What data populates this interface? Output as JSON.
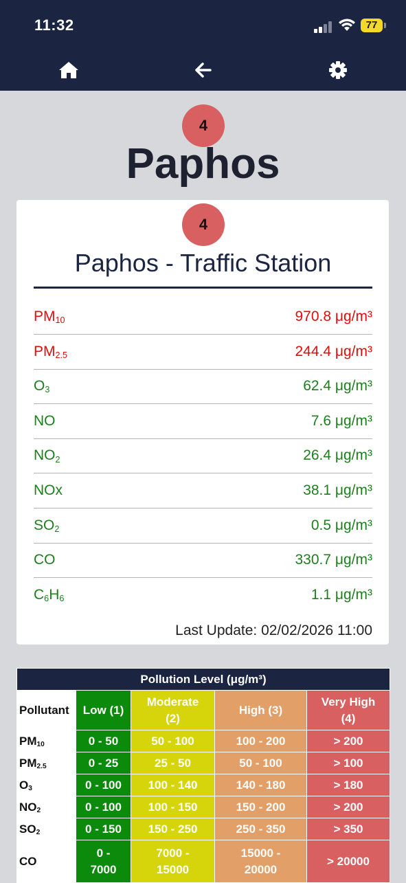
{
  "status_bar": {
    "time": "11:32",
    "battery": "77"
  },
  "nav": {
    "home_icon": "home-icon",
    "back_icon": "arrow-left-icon",
    "settings_icon": "gear-icon"
  },
  "city": {
    "name": "Paphos",
    "level": "4"
  },
  "station": {
    "name": "Paphos - Traffic Station",
    "level": "4",
    "pollutants": [
      {
        "base": "PM",
        "sub": "10",
        "tail": "",
        "value": "970.8 μg/m³",
        "status": "red"
      },
      {
        "base": "PM",
        "sub": "2.5",
        "tail": "",
        "value": "244.4 μg/m³",
        "status": "red"
      },
      {
        "base": "O",
        "sub": "3",
        "tail": "",
        "value": "62.4 μg/m³",
        "status": "green"
      },
      {
        "base": "NO",
        "sub": "",
        "tail": "",
        "value": "7.6 μg/m³",
        "status": "green"
      },
      {
        "base": "NO",
        "sub": "2",
        "tail": "",
        "value": "26.4 μg/m³",
        "status": "green"
      },
      {
        "base": "NOx",
        "sub": "",
        "tail": "",
        "value": "38.1 μg/m³",
        "status": "green"
      },
      {
        "base": "SO",
        "sub": "2",
        "tail": "",
        "value": "0.5 μg/m³",
        "status": "green"
      },
      {
        "base": "CO",
        "sub": "",
        "tail": "",
        "value": "330.7 μg/m³",
        "status": "green"
      },
      {
        "base": "C",
        "sub": "6",
        "tail": "H",
        "sub2": "6",
        "value": "1.1 μg/m³",
        "status": "green"
      }
    ],
    "last_update": "Last Update: 02/02/2026 11:00"
  },
  "levels_table": {
    "caption": "Pollution Level (μg/m³)",
    "headers": {
      "pollutant": "Pollutant",
      "low": "Low (1)",
      "moderate_1": "Moderate",
      "moderate_2": "(2)",
      "high": "High (3)",
      "very_high_1": "Very High",
      "very_high_2": "(4)"
    },
    "rows": [
      {
        "base": "PM",
        "sub": "10",
        "low": "0 - 50",
        "moderate": "50 - 100",
        "high": "100 - 200",
        "very_high": "> 200"
      },
      {
        "base": "PM",
        "sub": "2.5",
        "low": "0 - 25",
        "moderate": "25 - 50",
        "high": "50 - 100",
        "very_high": "> 100"
      },
      {
        "base": "O",
        "sub": "3",
        "low": "0 - 100",
        "moderate": "100 - 140",
        "high": "140 - 180",
        "very_high": "> 180"
      },
      {
        "base": "NO",
        "sub": "2",
        "low": "0 - 100",
        "moderate": "100 - 150",
        "high": "150 - 200",
        "very_high": "> 200"
      },
      {
        "base": "SO",
        "sub": "2",
        "low": "0 - 150",
        "moderate": "150 - 250",
        "high": "250 - 350",
        "very_high": "> 350"
      },
      {
        "base": "CO",
        "sub": "",
        "low_1": "0 -",
        "low_2": "7000",
        "moderate_1": "7000 -",
        "moderate_2": "15000",
        "high_1": "15000 -",
        "high_2": "20000",
        "very_high": "> 20000"
      }
    ]
  },
  "colors": {
    "header_bg": "#1b2541",
    "page_bg": "#d7d8dc",
    "level_badge": "#d96060",
    "value_red": "#e20c0c",
    "value_green": "#1c7f1c",
    "low": "#0b8a0b",
    "moderate": "#d6d50b",
    "high": "#e39f68",
    "very_high": "#d96060"
  }
}
